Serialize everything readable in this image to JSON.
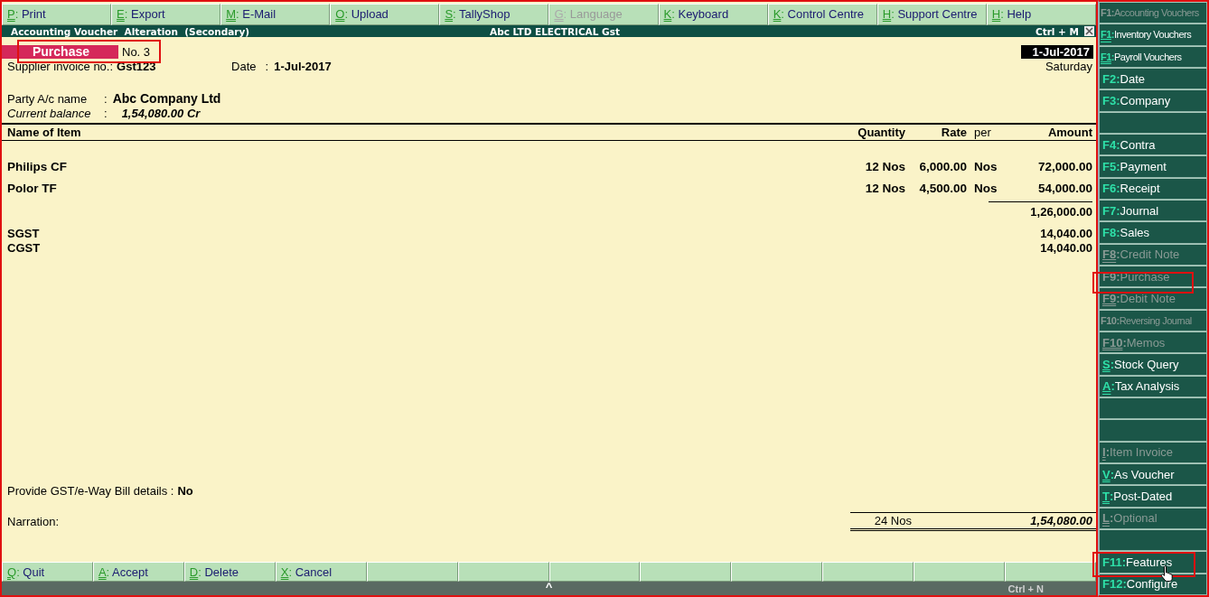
{
  "top_menu": [
    {
      "key": "P",
      "sep": ":",
      "label": "Print",
      "disabled": false
    },
    {
      "key": "E",
      "sep": ":",
      "label": "Export",
      "disabled": false
    },
    {
      "key": "M",
      "sep": ":",
      "label": "E-Mail",
      "disabled": false
    },
    {
      "key": "O",
      "sep": ":",
      "label": "Upload",
      "disabled": false
    },
    {
      "key": "S",
      "sep": ":",
      "label": "TallyShop",
      "disabled": false
    },
    {
      "key": "G",
      "sep": ":",
      "label": "Language",
      "disabled": true
    },
    {
      "key": "K",
      "sep": ":",
      "label": "Keyboard",
      "disabled": false
    },
    {
      "key": "K",
      "sep": ":",
      "label": "Control Centre",
      "disabled": false
    },
    {
      "key": "H",
      "sep": ":",
      "label": "Support Centre",
      "disabled": false
    },
    {
      "key": "H",
      "sep": ":",
      "label": "Help",
      "disabled": false
    }
  ],
  "title_bar": {
    "title": "Accounting Voucher  Alteration  (Secondary)",
    "company": "Abc LTD ELECTRICAL Gst",
    "shortcut": "Ctrl + M"
  },
  "voucher": {
    "type": "Purchase",
    "number": "No. 3",
    "date": "1-Jul-2017",
    "day": "Saturday",
    "supplier_invoice_label": "Supplier invoice no.:",
    "supplier_invoice": "Gst123",
    "date_label": "Date",
    "date_sep": ":",
    "invoice_date": "1-Jul-2017",
    "party_label": "Party A/c name",
    "party_sep": ":",
    "party": "Abc Company Ltd",
    "balance_label": "Current balance",
    "balance_sep": ":",
    "balance": "1,54,080.00 Cr"
  },
  "table": {
    "columns": [
      "Name of Item",
      "Quantity",
      "Rate",
      "per",
      "Amount"
    ],
    "rows": [
      {
        "kind": "item",
        "name": "Philips CF",
        "quantity": "12 Nos",
        "rate": "6,000.00",
        "per": "Nos",
        "amount": "72,000.00"
      },
      {
        "kind": "item",
        "name": "Polor TF",
        "quantity": "12 Nos",
        "rate": "4,500.00",
        "per": "Nos",
        "amount": "54,000.00"
      },
      {
        "kind": "subtotal",
        "amount": "1,26,000.00"
      },
      {
        "kind": "ledger",
        "name": "SGST",
        "amount": "14,040.00"
      },
      {
        "kind": "ledger",
        "name": "CGST",
        "amount": "14,040.00"
      }
    ]
  },
  "gst_details": {
    "label": "Provide GST/e-Way Bill details :",
    "value": "No"
  },
  "narration": {
    "label": "Narration:",
    "total_quantity": "24 Nos",
    "total_amount": "1,54,080.00"
  },
  "bottom_buttons": [
    {
      "kind": "action",
      "key": "Q",
      "sep": ":",
      "label": "Quit"
    },
    {
      "kind": "action",
      "key": "A",
      "sep": ":",
      "label": "Accept"
    },
    {
      "kind": "action",
      "key": "D",
      "sep": ":",
      "label": "Delete"
    },
    {
      "kind": "action",
      "key": "X",
      "sep": ":",
      "label": "Cancel"
    },
    {
      "kind": "blank"
    },
    {
      "kind": "blank"
    },
    {
      "kind": "blank"
    },
    {
      "kind": "blank"
    },
    {
      "kind": "blank"
    },
    {
      "kind": "blank"
    },
    {
      "kind": "blank"
    },
    {
      "kind": "blank"
    }
  ],
  "status_bar": {
    "arrow": "^",
    "shortcut": "Ctrl + N"
  },
  "sidebar": [
    {
      "kind": "action",
      "key": "F1",
      "sep": ":",
      "label": "Accounting Vouchers",
      "disabled": true,
      "underline": false,
      "small": true
    },
    {
      "kind": "action",
      "key": "F1",
      "sep": ":",
      "label": "Inventory Vouchers",
      "disabled": false,
      "underline": true,
      "small": true
    },
    {
      "kind": "action",
      "key": "F1",
      "sep": ":",
      "label": "Payroll Vouchers",
      "disabled": false,
      "underline": true,
      "small": true
    },
    {
      "kind": "action",
      "key": "F2",
      "sep": ":",
      "label": "Date",
      "disabled": false,
      "underline": false,
      "small": false
    },
    {
      "kind": "action",
      "key": "F3",
      "sep": ":",
      "label": "Company",
      "disabled": false,
      "underline": false,
      "small": false
    },
    {
      "kind": "blank"
    },
    {
      "kind": "action",
      "key": "F4",
      "sep": ":",
      "label": "Contra",
      "disabled": false,
      "underline": false,
      "small": false
    },
    {
      "kind": "action",
      "key": "F5",
      "sep": ":",
      "label": "Payment",
      "disabled": false,
      "underline": false,
      "small": false
    },
    {
      "kind": "action",
      "key": "F6",
      "sep": ":",
      "label": "Receipt",
      "disabled": false,
      "underline": false,
      "small": false
    },
    {
      "kind": "action",
      "key": "F7",
      "sep": ":",
      "label": "Journal",
      "disabled": false,
      "underline": false,
      "small": false
    },
    {
      "kind": "action",
      "key": "F8",
      "sep": ":",
      "label": "Sales",
      "disabled": false,
      "underline": false,
      "small": false
    },
    {
      "kind": "action",
      "key": "F8",
      "sep": ":",
      "label": "Credit Note",
      "disabled": true,
      "underline": true,
      "small": false
    },
    {
      "kind": "action",
      "key": "F9",
      "sep": ":",
      "label": "Purchase",
      "disabled": true,
      "underline": false,
      "small": false
    },
    {
      "kind": "action",
      "key": "F9",
      "sep": ":",
      "label": "Debit Note",
      "disabled": true,
      "underline": true,
      "small": false
    },
    {
      "kind": "action",
      "key": "F10",
      "sep": ":",
      "label": "Reversing Journal",
      "disabled": true,
      "underline": false,
      "small": true
    },
    {
      "kind": "action",
      "key": "F10",
      "sep": ":",
      "label": "Memos",
      "disabled": true,
      "underline": true,
      "small": false
    },
    {
      "kind": "action",
      "key": "S",
      "sep": ":",
      "label": "Stock Query",
      "disabled": false,
      "underline": true,
      "small": false
    },
    {
      "kind": "action",
      "key": "A",
      "sep": ":",
      "label": "Tax Analysis",
      "disabled": false,
      "underline": true,
      "small": false
    },
    {
      "kind": "blank"
    },
    {
      "kind": "blank"
    },
    {
      "kind": "action",
      "key": "I",
      "sep": ":",
      "label": "Item Invoice",
      "disabled": true,
      "underline": true,
      "small": false
    },
    {
      "kind": "action",
      "key": "V",
      "sep": ":",
      "label": "As Voucher",
      "disabled": false,
      "underline": true,
      "small": false
    },
    {
      "kind": "action",
      "key": "T",
      "sep": ":",
      "label": "Post-Dated",
      "disabled": false,
      "underline": true,
      "small": false
    },
    {
      "kind": "action",
      "key": "L",
      "sep": ":",
      "label": "Optional",
      "disabled": true,
      "underline": true,
      "small": false
    },
    {
      "kind": "blank"
    },
    {
      "kind": "action",
      "key": "F11",
      "sep": ":",
      "label": "Features",
      "disabled": false,
      "underline": false,
      "small": false
    },
    {
      "kind": "action",
      "key": "F12",
      "sep": ":",
      "label": "Configure",
      "disabled": false,
      "underline": false,
      "small": false
    }
  ]
}
